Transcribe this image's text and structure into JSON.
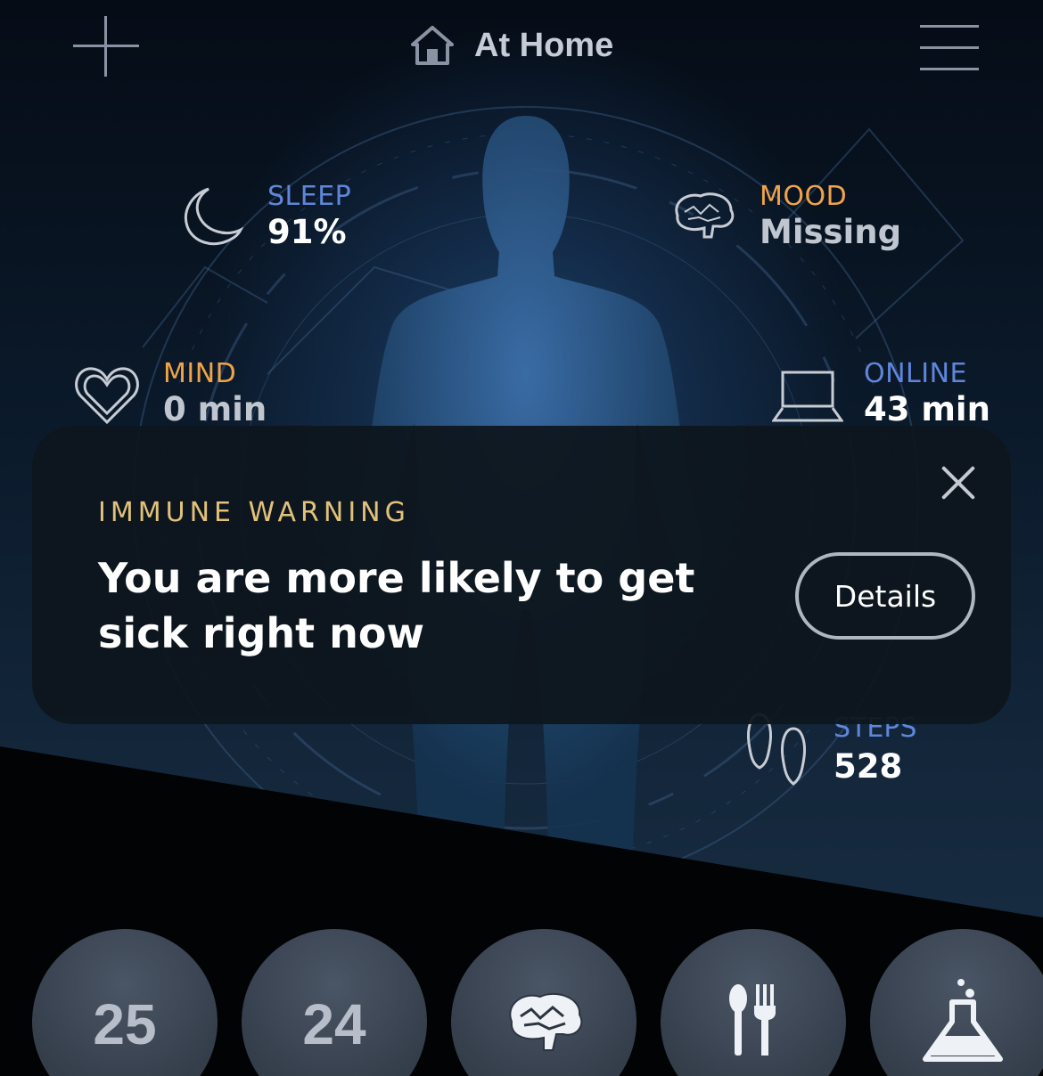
{
  "header": {
    "location_label": "At Home",
    "icons": {
      "left": "plus-icon",
      "location": "home-icon",
      "right": "hamburger-menu-icon"
    }
  },
  "metrics": {
    "sleep": {
      "label": "SLEEP",
      "value": "91%",
      "icon": "moon-icon",
      "label_color": "#5f86da"
    },
    "mood": {
      "label": "MOOD",
      "value": "Missing",
      "icon": "brain-icon",
      "label_color": "#f0a447"
    },
    "mind": {
      "label": "MIND",
      "value": "0 min",
      "icon": "heart-icon",
      "label_color": "#f0a447"
    },
    "online": {
      "label": "ONLINE",
      "value": "43 min",
      "icon": "laptop-icon",
      "label_color": "#5f86da"
    },
    "steps": {
      "label": "STEPS",
      "value": "528",
      "icon": "footprints-icon",
      "label_color": "#5f86da"
    }
  },
  "warning": {
    "eyebrow": "IMMUNE WARNING",
    "message": "You are more likely to get sick right now",
    "details_label": "Details",
    "eyebrow_color": "#e2c17a"
  },
  "bottom_nav": {
    "items": [
      {
        "label": "25"
      },
      {
        "label": "24"
      },
      {
        "icon": "brain-icon"
      },
      {
        "icon": "utensils-icon"
      },
      {
        "icon": "flask-icon"
      }
    ]
  },
  "colors": {
    "background": "#02050b",
    "accent_blue": "#5f86da",
    "accent_orange": "#f0a447",
    "card": "#0e161e"
  }
}
